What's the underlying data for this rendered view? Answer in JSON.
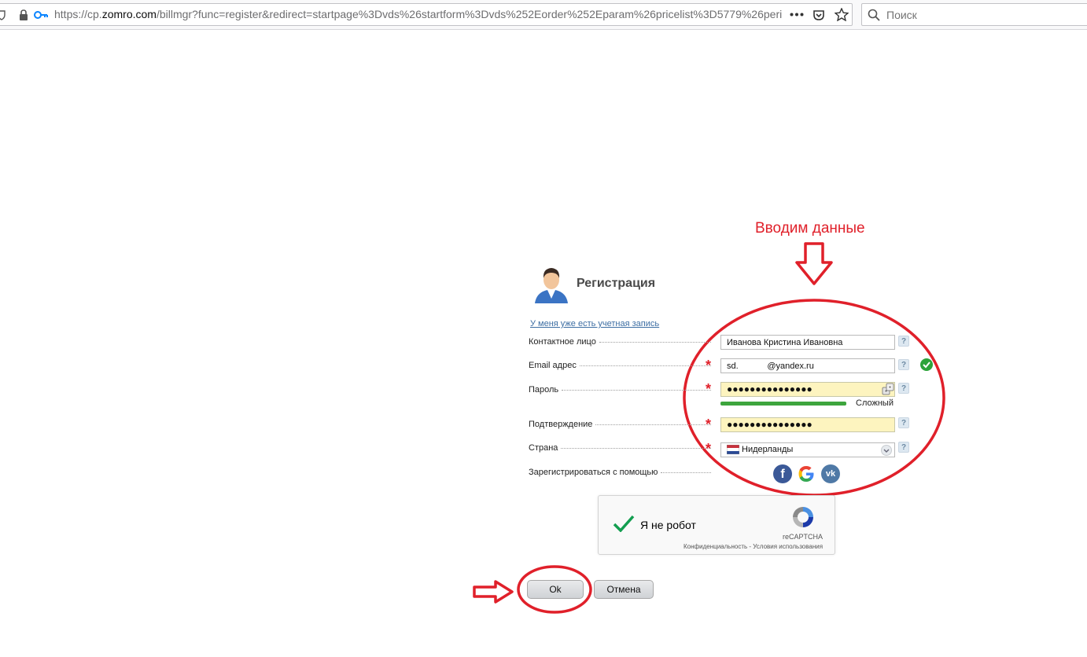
{
  "browser": {
    "url_prefix": "https://cp.",
    "url_domain": "zomro.com",
    "url_rest": "/billmgr?func=register&redirect=startpage%3Dvds%26startform%3Dvds%252Eorder%252Eparam%26pricelist%3D5779%26perio",
    "search_placeholder": "Поиск"
  },
  "annotation": {
    "title": "Вводим данные"
  },
  "form": {
    "title": "Регистрация",
    "have_account_link": "У меня уже есть учетная запись",
    "fields": {
      "contact": {
        "label": "Контактное лицо",
        "value": "Иванова Кристина Ивановна"
      },
      "email": {
        "label": "Email адрес",
        "value": "sd.            @yandex.ru"
      },
      "password": {
        "label": "Пароль",
        "value": "●●●●●●●●●●●●●●●",
        "strength": "Сложный",
        "strength_fraction": 1.0
      },
      "confirm": {
        "label": "Подтверждение",
        "value": "●●●●●●●●●●●●●●●"
      },
      "country": {
        "label": "Страна",
        "value": "Нидерланды"
      },
      "social": {
        "label": "Зарегистрироваться с помощью"
      }
    },
    "help_symbol": "?",
    "required_symbol": "*"
  },
  "captcha": {
    "label": "Я не робот",
    "brand": "reCAPTCHA",
    "links": "Конфиденциальность - Условия использования"
  },
  "buttons": {
    "ok": "Ok",
    "cancel": "Отмена"
  },
  "colors": {
    "annotation_red": "#e0202a",
    "strength_green": "#3da53d",
    "input_highlight": "#fdf4bf"
  }
}
